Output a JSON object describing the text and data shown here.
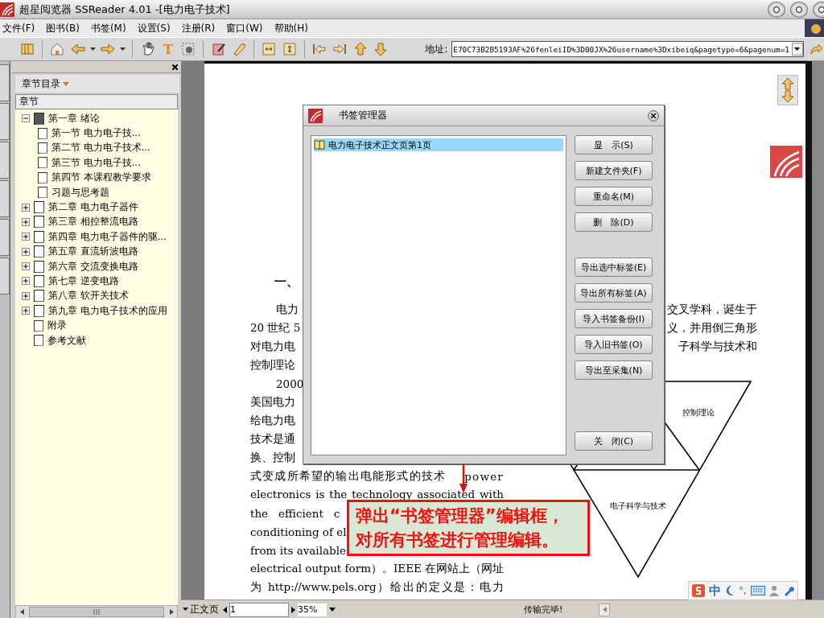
{
  "window": {
    "title": "超星阅览器 SSReader 4.01 -[电力电子技术]"
  },
  "menu": [
    "文件(F)",
    "图书(B)",
    "书签(M)",
    "设置(S)",
    "注册(R)",
    "窗口(W)",
    "帮助(H)"
  ],
  "toolbar": {
    "text_tool": "T",
    "address_label": "地址:",
    "address": "E70C73B2B5193AF%26fenleiID%3D00JX%26username%3Dxibeiq&pagetype=6&pagenum=1"
  },
  "sidebar": {
    "dropdown": "章节目录",
    "column": "章节",
    "tree": [
      {
        "label": "第一章 绪论",
        "kind": "chapter",
        "expanded": true,
        "children": [
          {
            "label": "第一节 电力电子技...",
            "kind": "page"
          },
          {
            "label": "第二节 电力电子技术...",
            "kind": "page"
          },
          {
            "label": "第三节 电力电子技...",
            "kind": "page"
          },
          {
            "label": "第四节 本课程教学要求",
            "kind": "page"
          },
          {
            "label": "习题与思考题",
            "kind": "page"
          }
        ]
      },
      {
        "label": "第二章 电力电子器件",
        "kind": "chapter",
        "expanded": false
      },
      {
        "label": "第三章 相控整流电路",
        "kind": "chapter",
        "expanded": false
      },
      {
        "label": "第四章 电力电子器件的驱...",
        "kind": "chapter",
        "expanded": false
      },
      {
        "label": "第五章 直流斩波电路",
        "kind": "chapter",
        "expanded": false
      },
      {
        "label": "第六章 交流变换电路",
        "kind": "chapter",
        "expanded": false
      },
      {
        "label": "第七章 逆变电路",
        "kind": "chapter",
        "expanded": false
      },
      {
        "label": "第八章 软开关技术",
        "kind": "chapter",
        "expanded": false
      },
      {
        "label": "第九章 电力电子技术的应用",
        "kind": "chapter",
        "expanded": false
      },
      {
        "label": "附录",
        "kind": "page"
      },
      {
        "label": "参考文献",
        "kind": "page"
      }
    ]
  },
  "page": {
    "heading": "一、",
    "top_rows": [
      {
        "kind": "indent",
        "left": "电力",
        "right": "交叉学科，诞生于"
      },
      {
        "kind": "plain",
        "left": "20 世纪 5",
        "right": "义，并用倒三角形"
      },
      {
        "kind": "plain",
        "left": "对电力电",
        "right": "子科学与技术和"
      },
      {
        "kind": "plain",
        "left": "控制理论"
      }
    ],
    "lines": [
      {
        "kind": "indent",
        "text": "2000"
      },
      {
        "kind": "plain",
        "text": "美国电力"
      },
      {
        "kind": "plain",
        "text": "给电力电"
      },
      {
        "kind": "plain",
        "text": "技术是通"
      },
      {
        "kind": "plain",
        "text": "换、控制"
      },
      {
        "kind": "split",
        "text": "式变成所希望的输出电能形式的技术",
        "right": "power"
      },
      {
        "kind": "full",
        "text": "electronics is the technology associated with"
      },
      {
        "kind": "plain",
        "text": "the   efficient   c"
      },
      {
        "kind": "plain",
        "text": "conditioning of el"
      },
      {
        "kind": "plain",
        "text": "from its available"
      },
      {
        "kind": "full",
        "text": "electrical output form）。IEEE 在网站上（网址"
      },
      {
        "kind": "full",
        "text": "为 http://www.pels.org）给出的定义是：电力"
      }
    ],
    "diagram": {
      "labels": [
        "控制理论",
        "电子科学与技术"
      ]
    }
  },
  "dialog": {
    "title": "书签管理器",
    "items": [
      {
        "label": "电力电子技术正文页第1页",
        "selected": true
      }
    ],
    "buttons": [
      {
        "label": "显　示(S)",
        "kind": "action"
      },
      {
        "label": "新建文件夹(F)",
        "kind": "action"
      },
      {
        "label": "重命名(M)",
        "kind": "action"
      },
      {
        "label": "删　除(D)",
        "kind": "action"
      },
      {
        "label": "导出选中标签(E)",
        "kind": "export"
      },
      {
        "label": "导出所有标签(A)",
        "kind": "export"
      },
      {
        "label": "导入书签备份(I)",
        "kind": "export"
      },
      {
        "label": "导入旧书签(O)",
        "kind": "export"
      },
      {
        "label": "导出至采集(N)",
        "kind": "export"
      },
      {
        "label": "关　闭(C)",
        "kind": "close"
      }
    ]
  },
  "callout": {
    "lines": [
      "弹出“书签管理器”编辑框，",
      "对所有书签进行管理编辑。"
    ]
  },
  "status": {
    "page_menu": "正文页",
    "page": "1",
    "zoom": "35%",
    "message": "传输完毕!"
  },
  "ime": {
    "mode": "中",
    "punct": "°,"
  }
}
